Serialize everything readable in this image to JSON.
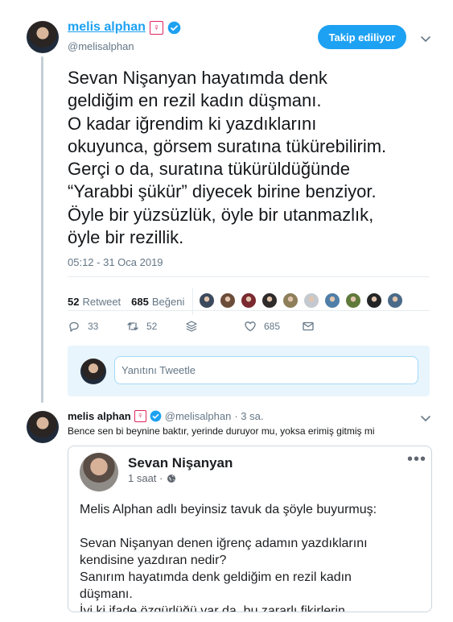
{
  "tweet": {
    "display_name": "melis alphan",
    "name_badge": "♀",
    "handle": "@melisalphan",
    "follow_label": "Takip ediliyor",
    "text_lines": [
      "Sevan Nişanyan hayatımda denk",
      "geldiğim en rezil kadın düşmanı.",
      "O kadar iğrendim ki yazdıklarını",
      "okuyunca, görsem suratına tükürebilirim.",
      "Gerçi o da, suratına tükürüldüğünde",
      "“Yarabbi şükür” diyecek birine benziyor.",
      "Öyle bir yüzsüzlük, öyle bir utanmazlık,",
      "öyle bir rezillik."
    ],
    "timestamp": "05:12 - 31 Oca 2019",
    "retweet_count": "52",
    "retweet_label": "Retweet",
    "like_count": "685",
    "like_label": "Beğeni",
    "liker_colors": [
      "#3c4a5e",
      "#6b4d3a",
      "#7a2a30",
      "#2e2b2a",
      "#8d7f5a",
      "#c3c9cf",
      "#4f7ea8",
      "#5f7a3a",
      "#232526",
      "#4b6a8a"
    ],
    "actions": {
      "reply_count": "33",
      "retweet_count": "52",
      "like_count": "685"
    },
    "reply_placeholder": "Yanıtını Tweetle"
  },
  "reply": {
    "display_name": "melis alphan",
    "name_badge": "♀",
    "handle": "@melisalphan",
    "time": "· 3 sa.",
    "text": "Bence sen bi beynine baktır, yerinde duruyor mu, yoksa erimiş gitmiş mi",
    "embed": {
      "author": "Sevan Nişanyan",
      "meta": "1 saat ·",
      "more": "•••",
      "body_lines": [
        "Melis Alphan adlı beyinsiz tavuk da şöyle buyurmuş:",
        "",
        "Sevan Nişanyan denen iğrenç adamın yazdıklarını",
        "kendisine yazdıran nedir?",
        "Sanırım hayatımda denk geldiğim en rezil kadın",
        "düşmanı.",
        "İyi ki ifade özgürlüğü var da, bu zararlı fikirlerin"
      ]
    }
  },
  "colors": {
    "accent": "#1da1f2",
    "female_badge": "#e0245e",
    "muted": "#657786"
  }
}
